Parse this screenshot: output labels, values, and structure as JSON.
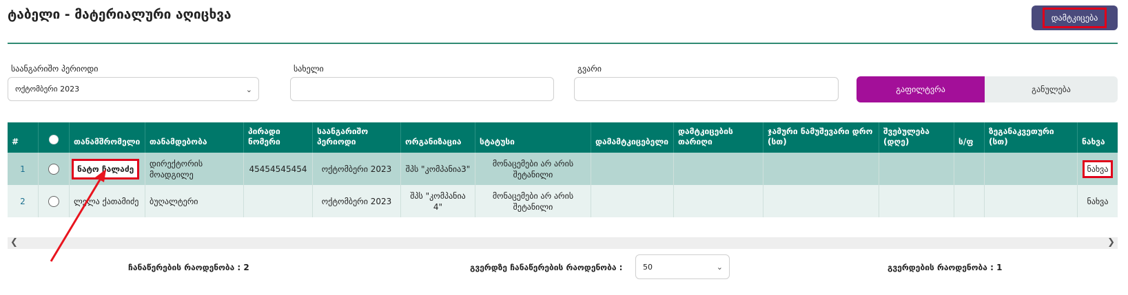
{
  "header": {
    "title": "ტაბელი - მატერიალური აღიცხვა",
    "approve_label": "დამტკიცება"
  },
  "filters": {
    "period_label": "საანგარიშო პერიოდი",
    "period_value": "ოქტომბერი 2023",
    "name_label": "სახელი",
    "name_value": "",
    "surname_label": "გვარი",
    "surname_value": "",
    "filter_label": "გაფილტვრა",
    "reset_label": "განულება"
  },
  "table": {
    "columns": [
      "#",
      "",
      "თანამშრომელი",
      "თანამდებობა",
      "პირადი ნომერი",
      "საანგარიშო პერიოდი",
      "ორგანიზაცია",
      "სტატუსი",
      "დამამტკიცებელი",
      "დამტკიცების თარიღი",
      "ჯამური ნამუშევარი დრო (სთ)",
      "შვებულება (დღე)",
      "ს/ფ",
      "ზეგანაკვეთური (სთ)",
      "ნახვა"
    ],
    "rows": [
      {
        "num": "1",
        "employee": "ნატო ჩალაძე",
        "position": "დირექტორის მოადგილე",
        "personal_id": "45454545454",
        "period": "ოქტომბერი 2023",
        "org": "შპს \"კომპანია3\"",
        "status": "მონაცემები არ არის შეტანილი",
        "approver": "",
        "approve_date": "",
        "total_hours": "",
        "vacation": "",
        "sick": "",
        "overtime": "",
        "view": "ნახვა"
      },
      {
        "num": "2",
        "employee": "ლელა ქათამიძე",
        "position": "ბუღალტერი",
        "personal_id": "",
        "period": "ოქტომბერი 2023",
        "org": "შპს \"კომპანია 4\"",
        "status": "მონაცემები არ არის შეტანილი",
        "approver": "",
        "approve_date": "",
        "total_hours": "",
        "vacation": "",
        "sick": "",
        "overtime": "",
        "view": "ნახვა"
      }
    ]
  },
  "footer": {
    "records_count": "ჩანაწერების რაოდენობა : 2",
    "per_page_label": "გვერდზე ჩანაწერების რაოდენობა :",
    "per_page_value": "50",
    "pages_count": "გვერდების რაოდენობა : 1"
  },
  "colors": {
    "header_green": "#00786a",
    "row_selected": "#b5d6d1",
    "filter_button": "#a30f99",
    "approve_button": "#4a4a7c",
    "highlight": "#e0001a"
  }
}
